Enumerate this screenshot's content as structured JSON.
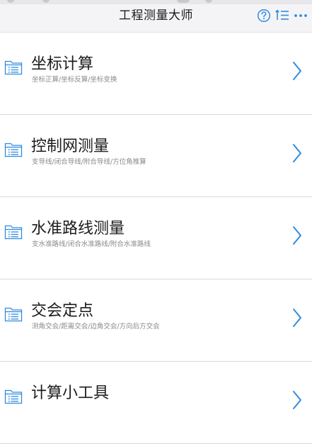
{
  "header": {
    "title": "工程测量大师",
    "icons": [
      "help-icon",
      "sort-list-icon",
      "more-icon"
    ]
  },
  "menu": [
    {
      "title": "坐标计算",
      "subtitle": "坐标正算/坐标反算/坐标变换",
      "icon": "folder-list-icon"
    },
    {
      "title": "控制网测量",
      "subtitle": "支导线/闭合导线/附合导线/方位角推算",
      "icon": "folder-list-icon"
    },
    {
      "title": "水准路线测量",
      "subtitle": "支水准路线/闭合水准路线/附合水准路线",
      "icon": "folder-list-icon"
    },
    {
      "title": "交会定点",
      "subtitle": "测角交会/距离交会/边角交会/方向后方交会",
      "icon": "folder-list-icon"
    },
    {
      "title": "计算小工具",
      "subtitle": "",
      "icon": "folder-list-icon"
    }
  ],
  "colors": {
    "accent": "#2f8be0",
    "header_bg": "#f4f4f6",
    "divider": "#d9d9dc",
    "subtitle": "#8a8a8a"
  }
}
